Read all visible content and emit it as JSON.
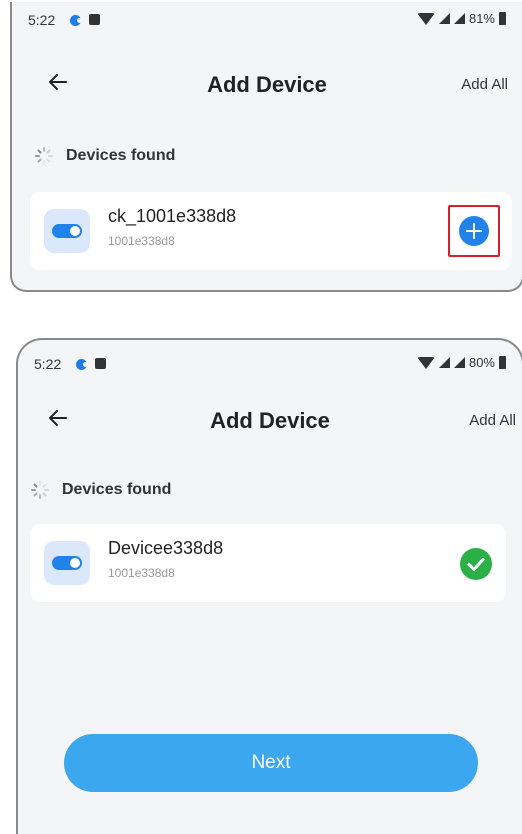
{
  "screens": [
    {
      "status": {
        "time": "5:22",
        "battery": "81%"
      },
      "header": {
        "title": "Add Device",
        "add_all_label": "Add All"
      },
      "section_title": "Devices found",
      "device": {
        "name": "ck_1001e338d8",
        "id": "1001e338d8",
        "action_icon": "plus-icon",
        "action_state": "add"
      }
    },
    {
      "status": {
        "time": "5:22",
        "battery": "80%"
      },
      "header": {
        "title": "Add Device",
        "add_all_label": "Add All"
      },
      "section_title": "Devices found",
      "device": {
        "name": "Devicee338d8",
        "id": "1001e338d8",
        "action_icon": "check-icon",
        "action_state": "added"
      },
      "next_label": "Next"
    }
  ],
  "colors": {
    "accent_blue": "#2183ea",
    "next_button": "#3aa7ef",
    "success_green": "#2ab046",
    "highlight_red": "#d8202a",
    "background": "#f4f5f7"
  },
  "icons": {
    "back": "arrow-left-icon",
    "loading": "spinner-icon",
    "device": "toggle-switch-icon",
    "wifi": "wifi-icon",
    "signal": "signal-icon",
    "battery": "battery-icon"
  }
}
